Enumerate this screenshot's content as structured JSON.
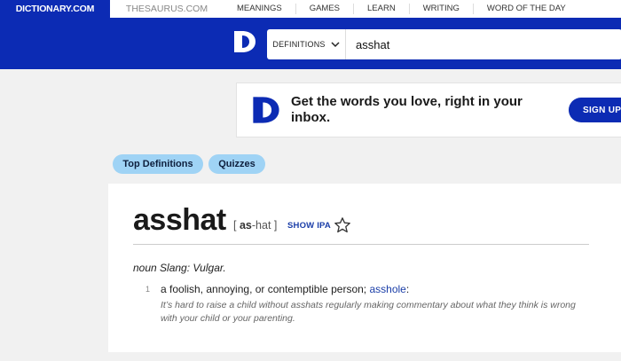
{
  "nav": {
    "brand": "DICTIONARY.COM",
    "thesaurus": "THESAURUS.COM",
    "links": [
      "MEANINGS",
      "GAMES",
      "LEARN",
      "WRITING",
      "WORD OF THE DAY"
    ]
  },
  "search": {
    "type_label": "DEFINITIONS",
    "query": "asshat"
  },
  "promo": {
    "text": "Get the words you love, right in your inbox.",
    "button": "SIGN UP"
  },
  "tabs": [
    "Top Definitions",
    "Quizzes"
  ],
  "entry": {
    "headword": "asshat",
    "pron_open": "[",
    "pron_stressed": "as",
    "pron_rest": "-hat",
    "pron_close": "]",
    "show_ipa": "SHOW IPA",
    "pos": "noun Slang: Vulgar.",
    "def_number": "1",
    "def_text": "a foolish, annoying, or contemptible person; ",
    "def_link": "asshole",
    "def_colon": ":",
    "example": "It’s hard to raise a child without asshats regularly making commentary about what they think is wrong with your child or your parenting."
  },
  "colors": {
    "brand_blue": "#0c2bb4",
    "pill_blue": "#9fd3f5",
    "link_blue": "#1b3ea8"
  },
  "icons": [
    "dictionary-logo-icon",
    "chevron-down-icon",
    "star-icon"
  ]
}
